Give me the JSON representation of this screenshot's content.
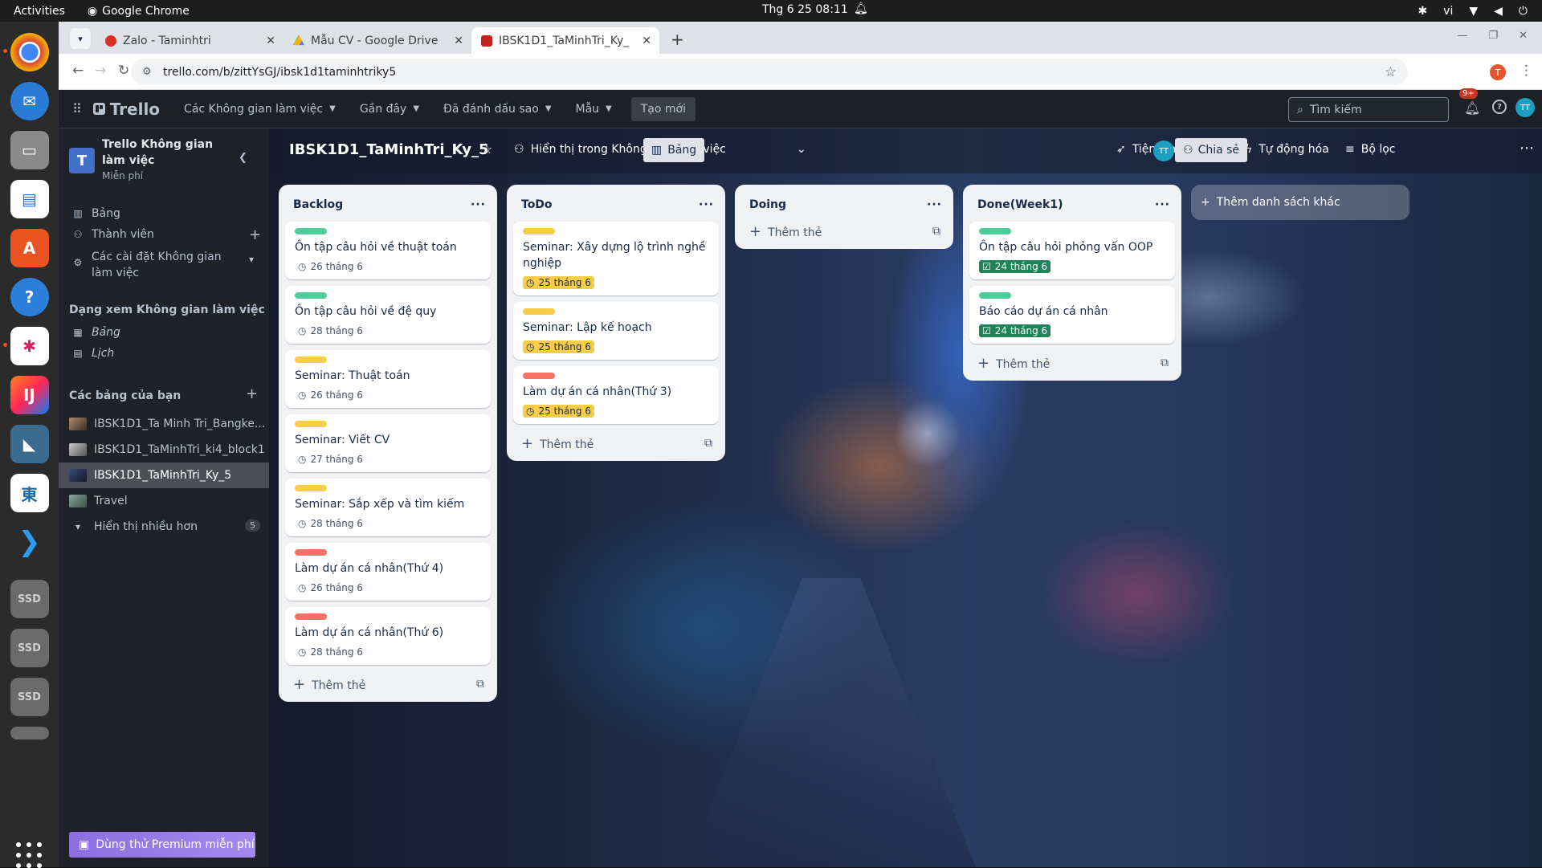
{
  "os": {
    "activities": "Activities",
    "app": "Google Chrome",
    "clock": "Thg 6 25  08:11",
    "lang": "vi"
  },
  "tabs": [
    {
      "title": "Zalo - Taminhtri",
      "color": "#d93025"
    },
    {
      "title": "Mẫu CV - Google Drive",
      "color": "#1a73e8"
    },
    {
      "title": "IBSK1D1_TaMinhTri_Ky_",
      "color": "#c5221f"
    }
  ],
  "url": "trello.com/b/zittYsGJ/ibsk1d1taminhtriky5",
  "profile_initial": "T",
  "header": {
    "brand": "Trello",
    "menus": [
      "Các Không gian làm việc",
      "Gần đây",
      "Đã đánh dấu sao",
      "Mẫu"
    ],
    "create": "Tạo mới",
    "search": "Tìm kiếm",
    "notif_badge": "9+",
    "avatar": "TT"
  },
  "sidebar": {
    "workspace": "Trello Không gian làm việc",
    "initial": "T",
    "plan": "Miễn phí",
    "items": [
      "Bảng",
      "Thành viên",
      "Các cài đặt Không gian làm việc"
    ],
    "views_header": "Dạng xem Không gian làm việc",
    "views": [
      "Bảng",
      "Lịch"
    ],
    "boards_header": "Các bảng của bạn",
    "boards": [
      "IBSK1D1_Ta Minh Tri_Bangke...",
      "IBSK1D1_TaMinhTri_ki4_block1",
      "IBSK1D1_TaMinhTri_Ky_5",
      "Travel"
    ],
    "more": "Hiển thị nhiều hơn",
    "more_count": "5",
    "premium": "Dùng thử Premium miễn phí"
  },
  "board": {
    "name": "IBSK1D1_TaMinhTri_Ky_5",
    "visibility": "Hiển thị trong Không gian làm việc",
    "view": "Bảng",
    "powerups": "Tiện ích bổ sung",
    "automation": "Tự động hóa",
    "filter": "Bộ lọc",
    "avatar": "TT",
    "share": "Chia sẻ"
  },
  "add_card": "Thêm thẻ",
  "add_list": "Thêm danh sách khác",
  "lists": [
    {
      "title": "Backlog",
      "cards": [
        {
          "label": "#4bce97",
          "title": "Ôn tập câu hỏi về thuật toán",
          "date": "26 tháng 6",
          "status": "plain"
        },
        {
          "label": "#4bce97",
          "title": "Ôn tập câu hỏi về đệ quy",
          "date": "28 tháng 6",
          "status": "plain"
        },
        {
          "label": "#f5cd47",
          "title": "Seminar: Thuật toán",
          "date": "26 tháng 6",
          "status": "plain"
        },
        {
          "label": "#f5cd47",
          "title": "Seminar: Viết CV",
          "date": "27 tháng 6",
          "status": "plain"
        },
        {
          "label": "#f5cd47",
          "title": "Seminar: Sắp xếp và tìm kiếm",
          "date": "28 tháng 6",
          "status": "plain"
        },
        {
          "label": "#f87168",
          "title": "Làm dự án cá nhân(Thứ 4)",
          "date": "26 tháng 6",
          "status": "plain"
        },
        {
          "label": "#f87168",
          "title": "Làm dự án cá nhân(Thứ 6)",
          "date": "28 tháng 6",
          "status": "plain"
        }
      ]
    },
    {
      "title": "ToDo",
      "cards": [
        {
          "label": "#f5cd47",
          "title": "Seminar: Xây dựng lộ trình nghề nghiệp",
          "date": "25 tháng 6",
          "status": "yel"
        },
        {
          "label": "#f5cd47",
          "title": "Seminar: Lập kế hoạch",
          "date": "25 tháng 6",
          "status": "yel"
        },
        {
          "label": "#f87168",
          "title": "Làm dự án cá nhân(Thứ 3)",
          "date": "25 tháng 6",
          "status": "yel"
        }
      ]
    },
    {
      "title": "Doing",
      "cards": []
    },
    {
      "title": "Done(Week1)",
      "cards": [
        {
          "label": "#4bce97",
          "title": "Ôn tập câu hỏi phỏng vấn OOP",
          "date": "24 tháng 6",
          "status": "grn"
        },
        {
          "label": "#4bce97",
          "title": "Báo cáo dự án cá nhân",
          "date": "24 tháng 6",
          "status": "grn"
        }
      ]
    }
  ]
}
